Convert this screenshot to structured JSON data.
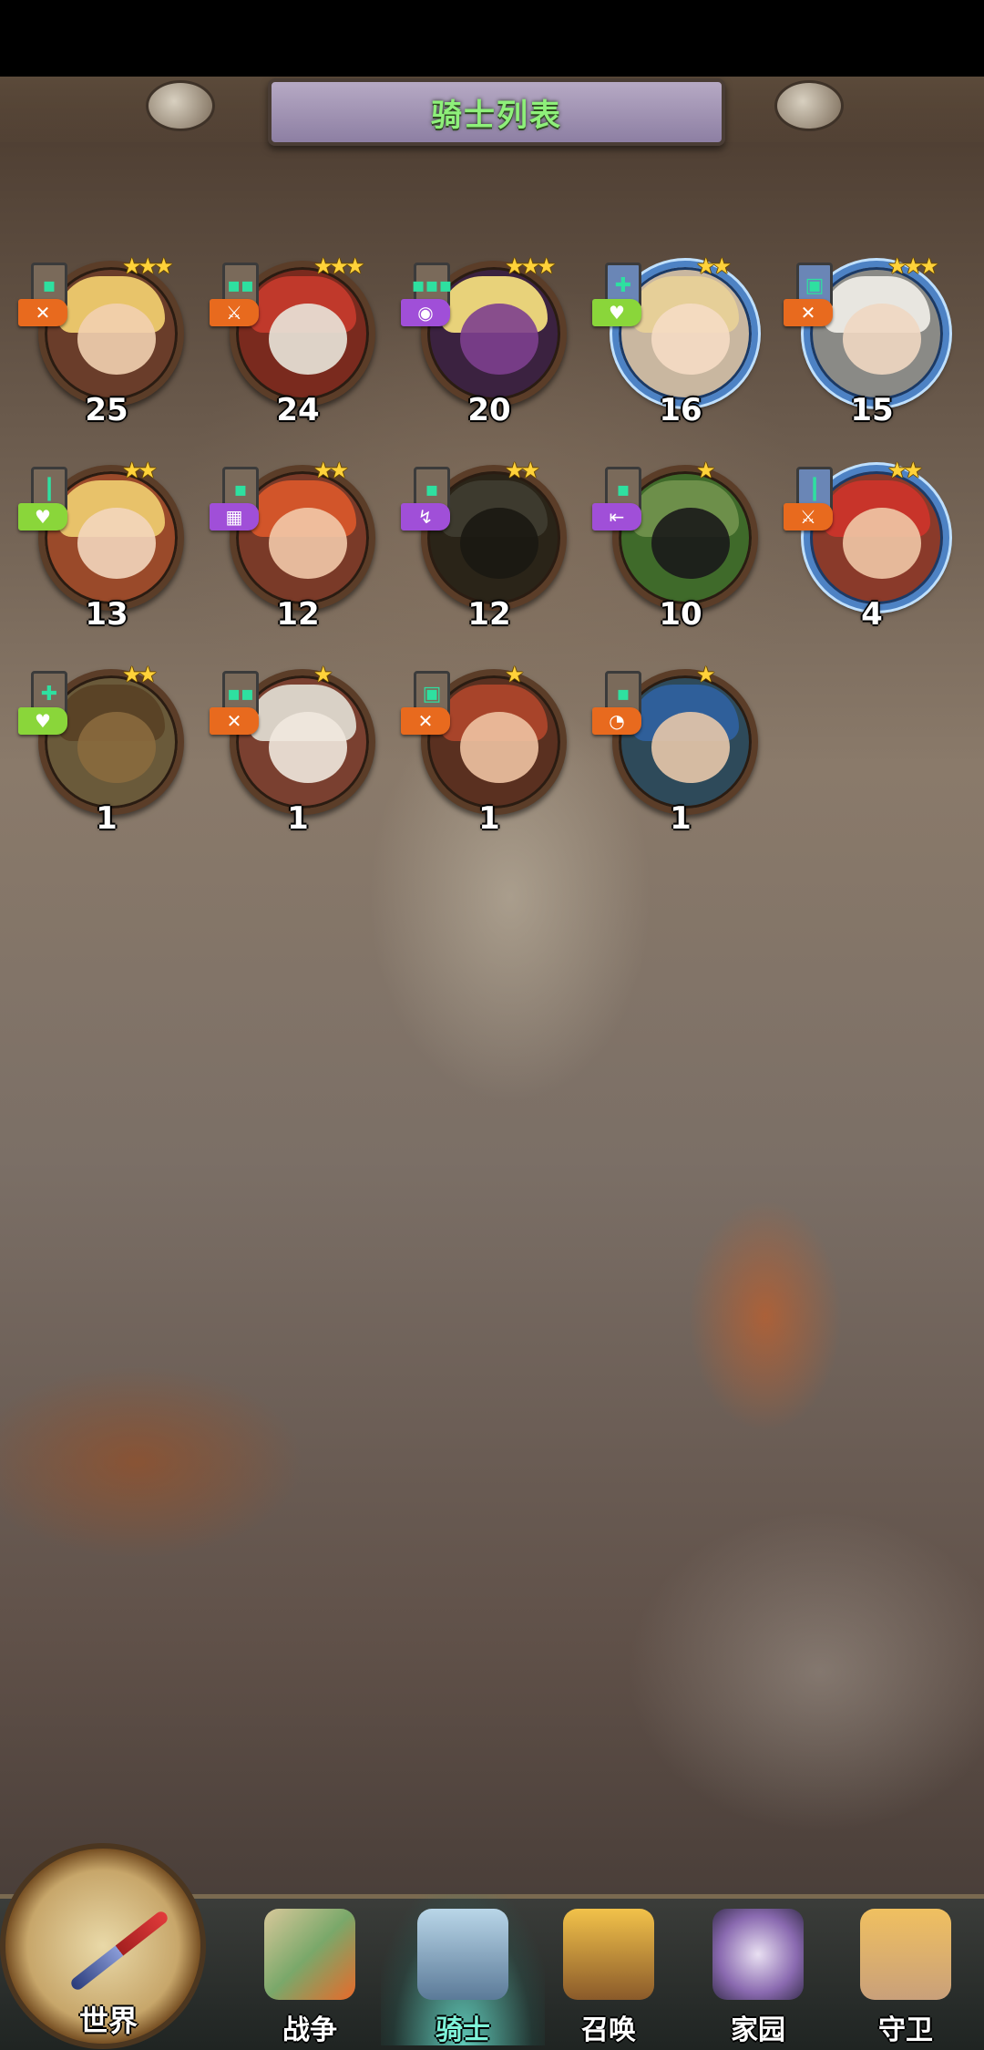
{
  "header": {
    "title": "骑士列表"
  },
  "knights": [
    {
      "level": "25",
      "stars": "★★★",
      "rarity_glyph": "▪",
      "class_glyph": "✕",
      "class_color": "orange"
    },
    {
      "level": "24",
      "stars": "★★★",
      "rarity_glyph": "▪▪",
      "class_glyph": "⚔",
      "class_color": "orange"
    },
    {
      "level": "20",
      "stars": "★★★",
      "rarity_glyph": "▪▪▪",
      "class_glyph": "◉",
      "class_color": "purple"
    },
    {
      "level": "16",
      "stars": "★★",
      "rarity_glyph": "✚",
      "class_glyph": "♥",
      "class_color": "green"
    },
    {
      "level": "15",
      "stars": "★★★",
      "rarity_glyph": "▣",
      "class_glyph": "✕",
      "class_color": "orange"
    },
    {
      "level": "13",
      "stars": "★★",
      "rarity_glyph": "┃",
      "class_glyph": "♥",
      "class_color": "green"
    },
    {
      "level": "12",
      "stars": "★★",
      "rarity_glyph": "▪",
      "class_glyph": "▦",
      "class_color": "purple"
    },
    {
      "level": "12",
      "stars": "★★",
      "rarity_glyph": "▪",
      "class_glyph": "↯",
      "class_color": "purple"
    },
    {
      "level": "10",
      "stars": "★",
      "rarity_glyph": "▪",
      "class_glyph": "⇤",
      "class_color": "purple"
    },
    {
      "level": "4",
      "stars": "★★",
      "rarity_glyph": "┃",
      "class_glyph": "⚔",
      "class_color": "orange"
    },
    {
      "level": "1",
      "stars": "★★",
      "rarity_glyph": "✚",
      "class_glyph": "♥",
      "class_color": "green"
    },
    {
      "level": "1",
      "stars": "★",
      "rarity_glyph": "▪▪",
      "class_glyph": "✕",
      "class_color": "orange"
    },
    {
      "level": "1",
      "stars": "★",
      "rarity_glyph": "▣",
      "class_glyph": "✕",
      "class_color": "orange"
    },
    {
      "level": "1",
      "stars": "★",
      "rarity_glyph": "▪",
      "class_glyph": "◔",
      "class_color": "orange"
    }
  ],
  "nav": {
    "world": "世界",
    "war": "战争",
    "knights": "骑士",
    "summon": "召唤",
    "home": "家园",
    "guard": "守卫"
  }
}
